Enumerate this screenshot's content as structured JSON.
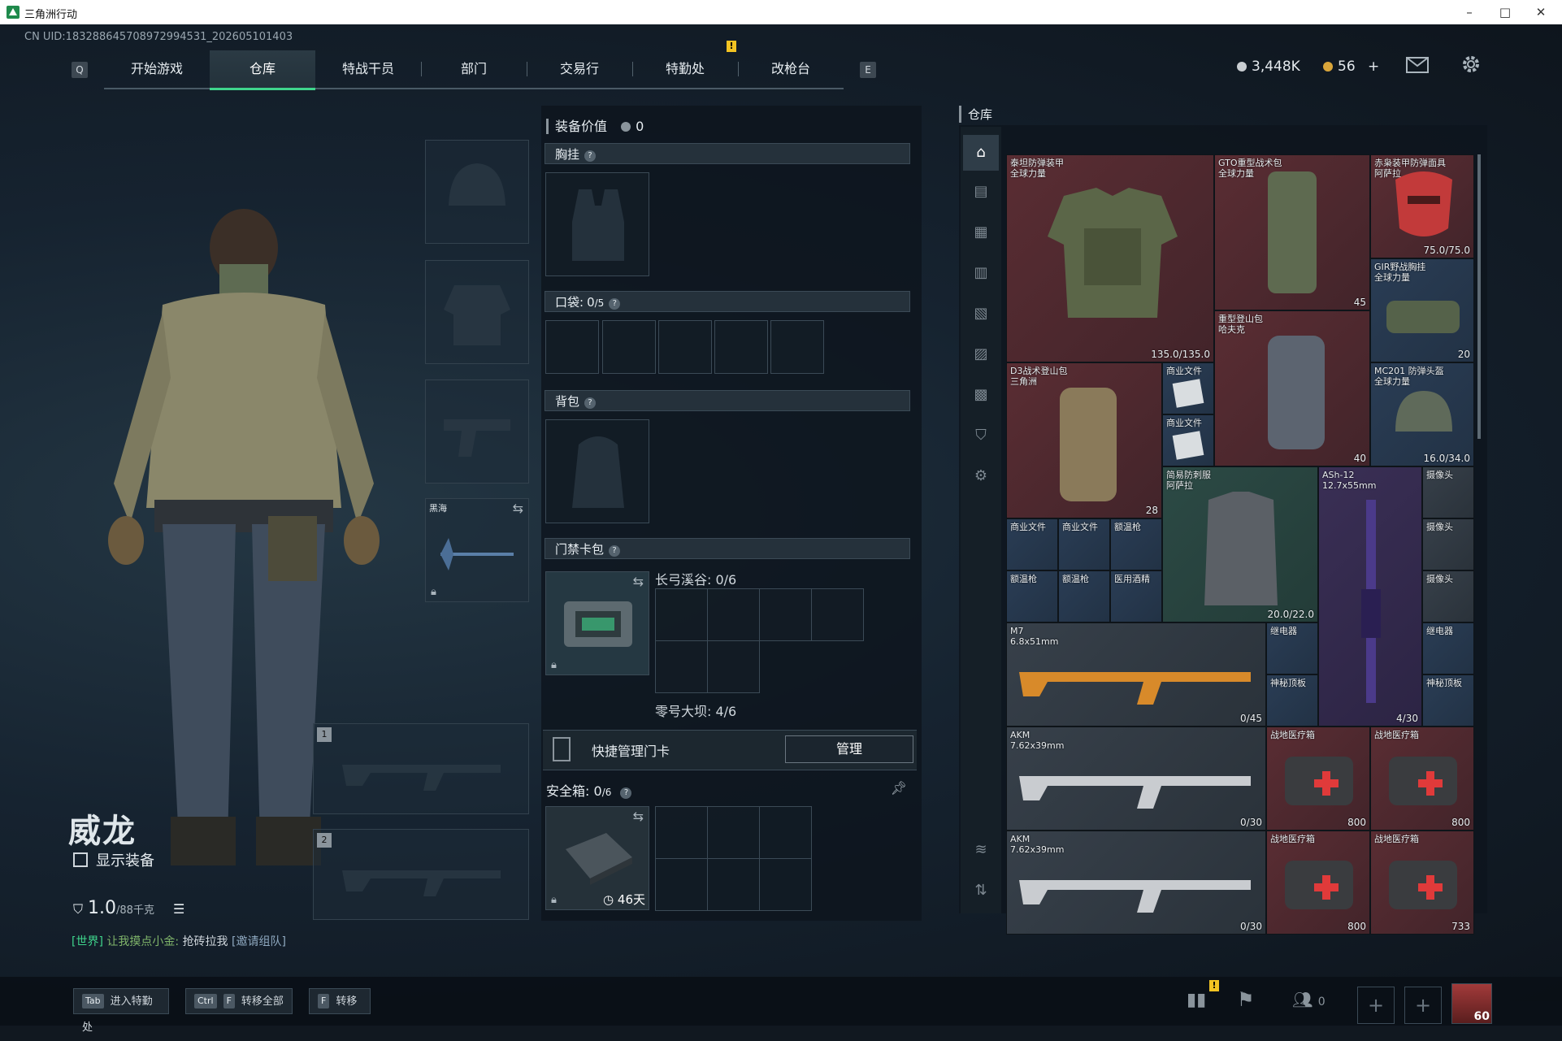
{
  "window": {
    "title": "三角洲行动",
    "minimize": "–",
    "maximize": "□",
    "close": "✕"
  },
  "uid": "CN UID:18328864570897299453­1_202605101403",
  "nav": {
    "left_key": "Q",
    "right_key": "E",
    "tabs": [
      "开始游戏",
      "仓库",
      "特战干员",
      "部门",
      "交易行",
      "特勤处",
      "改枪台"
    ],
    "active_tab": "仓库",
    "alert_mark": "!"
  },
  "currency": {
    "silver": "3,448K",
    "gold": "56",
    "gold_add": "+",
    "silver_color": "#c9ced2",
    "gold_color": "#d9a53a"
  },
  "operator": {
    "name": "威龙",
    "show_gear_label": "显示装备",
    "weight_value": "1.0",
    "weight_max": "/88千克"
  },
  "chat": {
    "channel": "[世界]",
    "speaker": "让我摸点小金:",
    "message": "抢砖拉我",
    "link": "[邀请组队]"
  },
  "equip_slots": {
    "melee_label": "黑海",
    "primary1_num": "1",
    "primary2_num": "2"
  },
  "middle": {
    "gear_value_label": "装备价值",
    "gear_value": "0",
    "chest_rig": "胸挂",
    "pockets_label": "口袋:",
    "pockets_used": "0",
    "pockets_total": "/5",
    "backpack": "背包",
    "keycard_case": "门禁卡包",
    "keycard_zone1": "长弓溪谷: 0/6",
    "keycard_zone2": "零号大坝: 4/6",
    "quick_manage": "快捷管理门卡",
    "manage_btn": "管理",
    "safebox_label": "安全箱:",
    "safebox_used": "0",
    "safebox_total": "/6",
    "safebox_days": "46天",
    "help": "?"
  },
  "warehouse": {
    "title": "仓库",
    "items": [
      {
        "name": "泰坦防弹装甲\n全球力量",
        "value": "135.0/135.0"
      },
      {
        "name": "GTO重型战术包\n全球力量",
        "value": "45"
      },
      {
        "name": "赤枭装甲防弹面具\n阿萨拉",
        "value": "75.0/75.0"
      },
      {
        "name": "GIR野战胸挂\n全球力量",
        "value": "20"
      },
      {
        "name": "D3战术登山包\n三角洲",
        "value": "28"
      },
      {
        "name": "商业文件",
        "value": ""
      },
      {
        "name": "商业文件",
        "value": ""
      },
      {
        "name": "重型登山包\n哈夫克",
        "value": "40"
      },
      {
        "name": "MC201 防弹头盔\n全球力量",
        "value": "16.0/34.0"
      },
      {
        "name": "简易防刺服\n阿萨拉",
        "value": "20.0/22.0"
      },
      {
        "name": "ASh-12\n12.7x55mm",
        "value": "4/30"
      },
      {
        "name": "摄像头",
        "value": ""
      },
      {
        "name": "摄像头",
        "value": ""
      },
      {
        "name": "摄像头",
        "value": ""
      },
      {
        "name": "商业文件",
        "value": ""
      },
      {
        "name": "商业文件",
        "value": ""
      },
      {
        "name": "额温枪",
        "value": ""
      },
      {
        "name": "额温枪",
        "value": ""
      },
      {
        "name": "额温枪",
        "value": ""
      },
      {
        "name": "医用酒精",
        "value": ""
      },
      {
        "name": "M7\n6.8x51mm",
        "value": "0/45"
      },
      {
        "name": "继电器",
        "value": ""
      },
      {
        "name": "神秘顶板",
        "value": ""
      },
      {
        "name": "继电器",
        "value": ""
      },
      {
        "name": "神秘顶板",
        "value": ""
      },
      {
        "name": "AKM\n7.62x39mm",
        "value": "0/30"
      },
      {
        "name": "战地医疗箱",
        "value": "800"
      },
      {
        "name": "战地医疗箱",
        "value": "800"
      },
      {
        "name": "AKM\n7.62x39mm",
        "value": "0/30"
      },
      {
        "name": "战地医疗箱",
        "value": "800"
      },
      {
        "name": "战地医疗箱",
        "value": "733"
      }
    ]
  },
  "bottom": {
    "btn1_key": "Tab",
    "btn1_label": "进入特勤处",
    "btn2_key1": "Ctrl",
    "btn2_key2": "F",
    "btn2_label": "转移全部",
    "btn3_key": "F",
    "btn3_label": "转移",
    "squad_count": "0",
    "level": "60",
    "alert_mark": "!"
  }
}
